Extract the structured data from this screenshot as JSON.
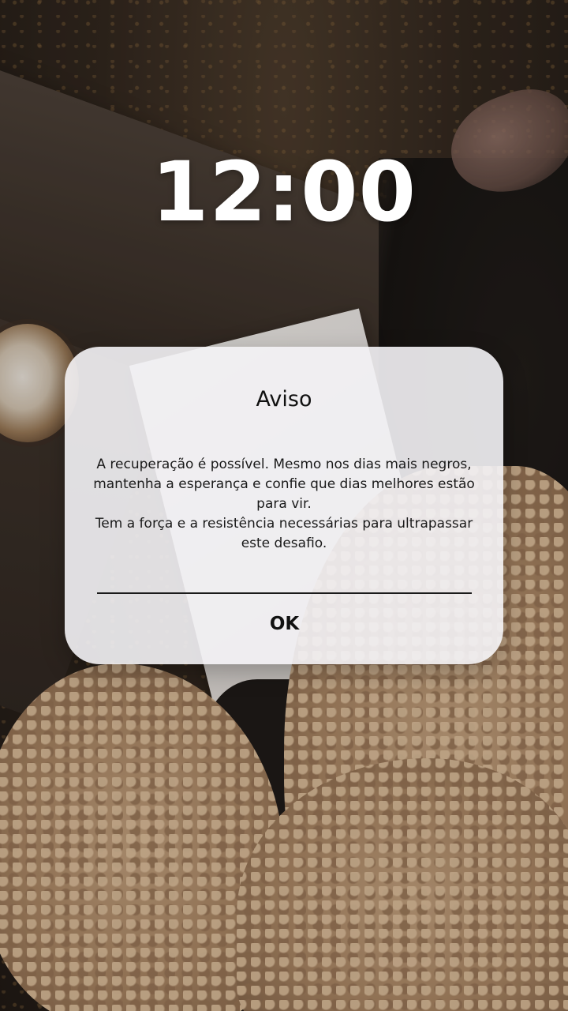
{
  "lock_screen": {
    "clock_time": "12:00"
  },
  "alert": {
    "title": "Aviso",
    "message_paragraphs": [
      "A recuperação é possível. Mesmo nos dias mais negros, mantenha a esperança e confie que dias melhores estão para vir.",
      "Tem a força e a resistência necessárias para ultrapassar este desafio."
    ],
    "ok_label": "OK"
  },
  "colors": {
    "dialog_background": "#f4f3f6",
    "text": "#111111",
    "clock_text": "#ffffff"
  }
}
